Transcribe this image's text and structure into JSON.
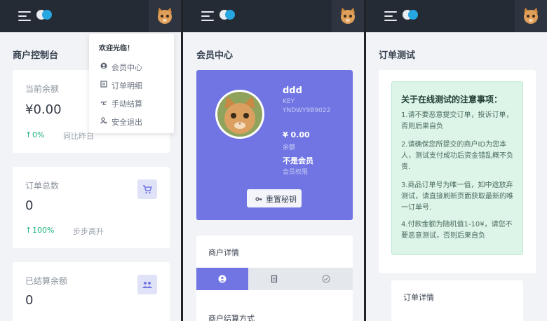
{
  "screen1": {
    "page_title": "商户控制台",
    "cards": [
      {
        "label": "当前余额",
        "value": "¥0.00",
        "change": "0%",
        "note": "同比昨日"
      },
      {
        "label": "订单总数",
        "value": "0",
        "change": "100%",
        "note": "步步高升",
        "icon": "cart-icon"
      },
      {
        "label": "已结算余额",
        "value": "0",
        "icon": "people-icon"
      }
    ],
    "dropdown": {
      "greeting": "欢迎光临！",
      "items": [
        {
          "label": "会员中心",
          "icon": "user-icon"
        },
        {
          "label": "订单明细",
          "icon": "list-icon"
        },
        {
          "label": "手动结算",
          "icon": "hand-icon"
        },
        {
          "label": "安全退出",
          "icon": "logout-icon"
        }
      ]
    }
  },
  "screen2": {
    "page_title": "会员中心",
    "profile": {
      "name": "ddd",
      "key_label": "KEY",
      "key_value": "YNDWY9B9022",
      "balance": "¥ 0.00",
      "balance_label": "余额",
      "membership": "不是会员",
      "membership_label": "会员权限",
      "reset_button": "重置秘钥"
    },
    "section_title": "商户详情",
    "partial_heading": "商户结算方式",
    "tabs": [
      "info-icon",
      "doc-icon",
      "check-icon"
    ]
  },
  "screen3": {
    "page_title": "订单测试",
    "notice": {
      "title": "关于在线测试的注意事项：",
      "items": [
        "1.请不要恶意提交订单，投诉订单，否则后果自负",
        "2.请确保您所提交的商户ID为您本人，测试支付成功后资金错乱概不负责.",
        "3.商品订单号为唯一值，如中途放弃测试，请直接刷新页面获取最新的唯一订单号.",
        "4.付款金额为随机值1-10¥，请您不要恶意测试，否则后果自负"
      ]
    },
    "section_title": "订单详情"
  },
  "colors": {
    "topbar": "#252b35",
    "accent": "#7075e3",
    "notice_bg": "#ddf4e9",
    "success": "#1fb27a",
    "toggle": "#27a7e2"
  }
}
